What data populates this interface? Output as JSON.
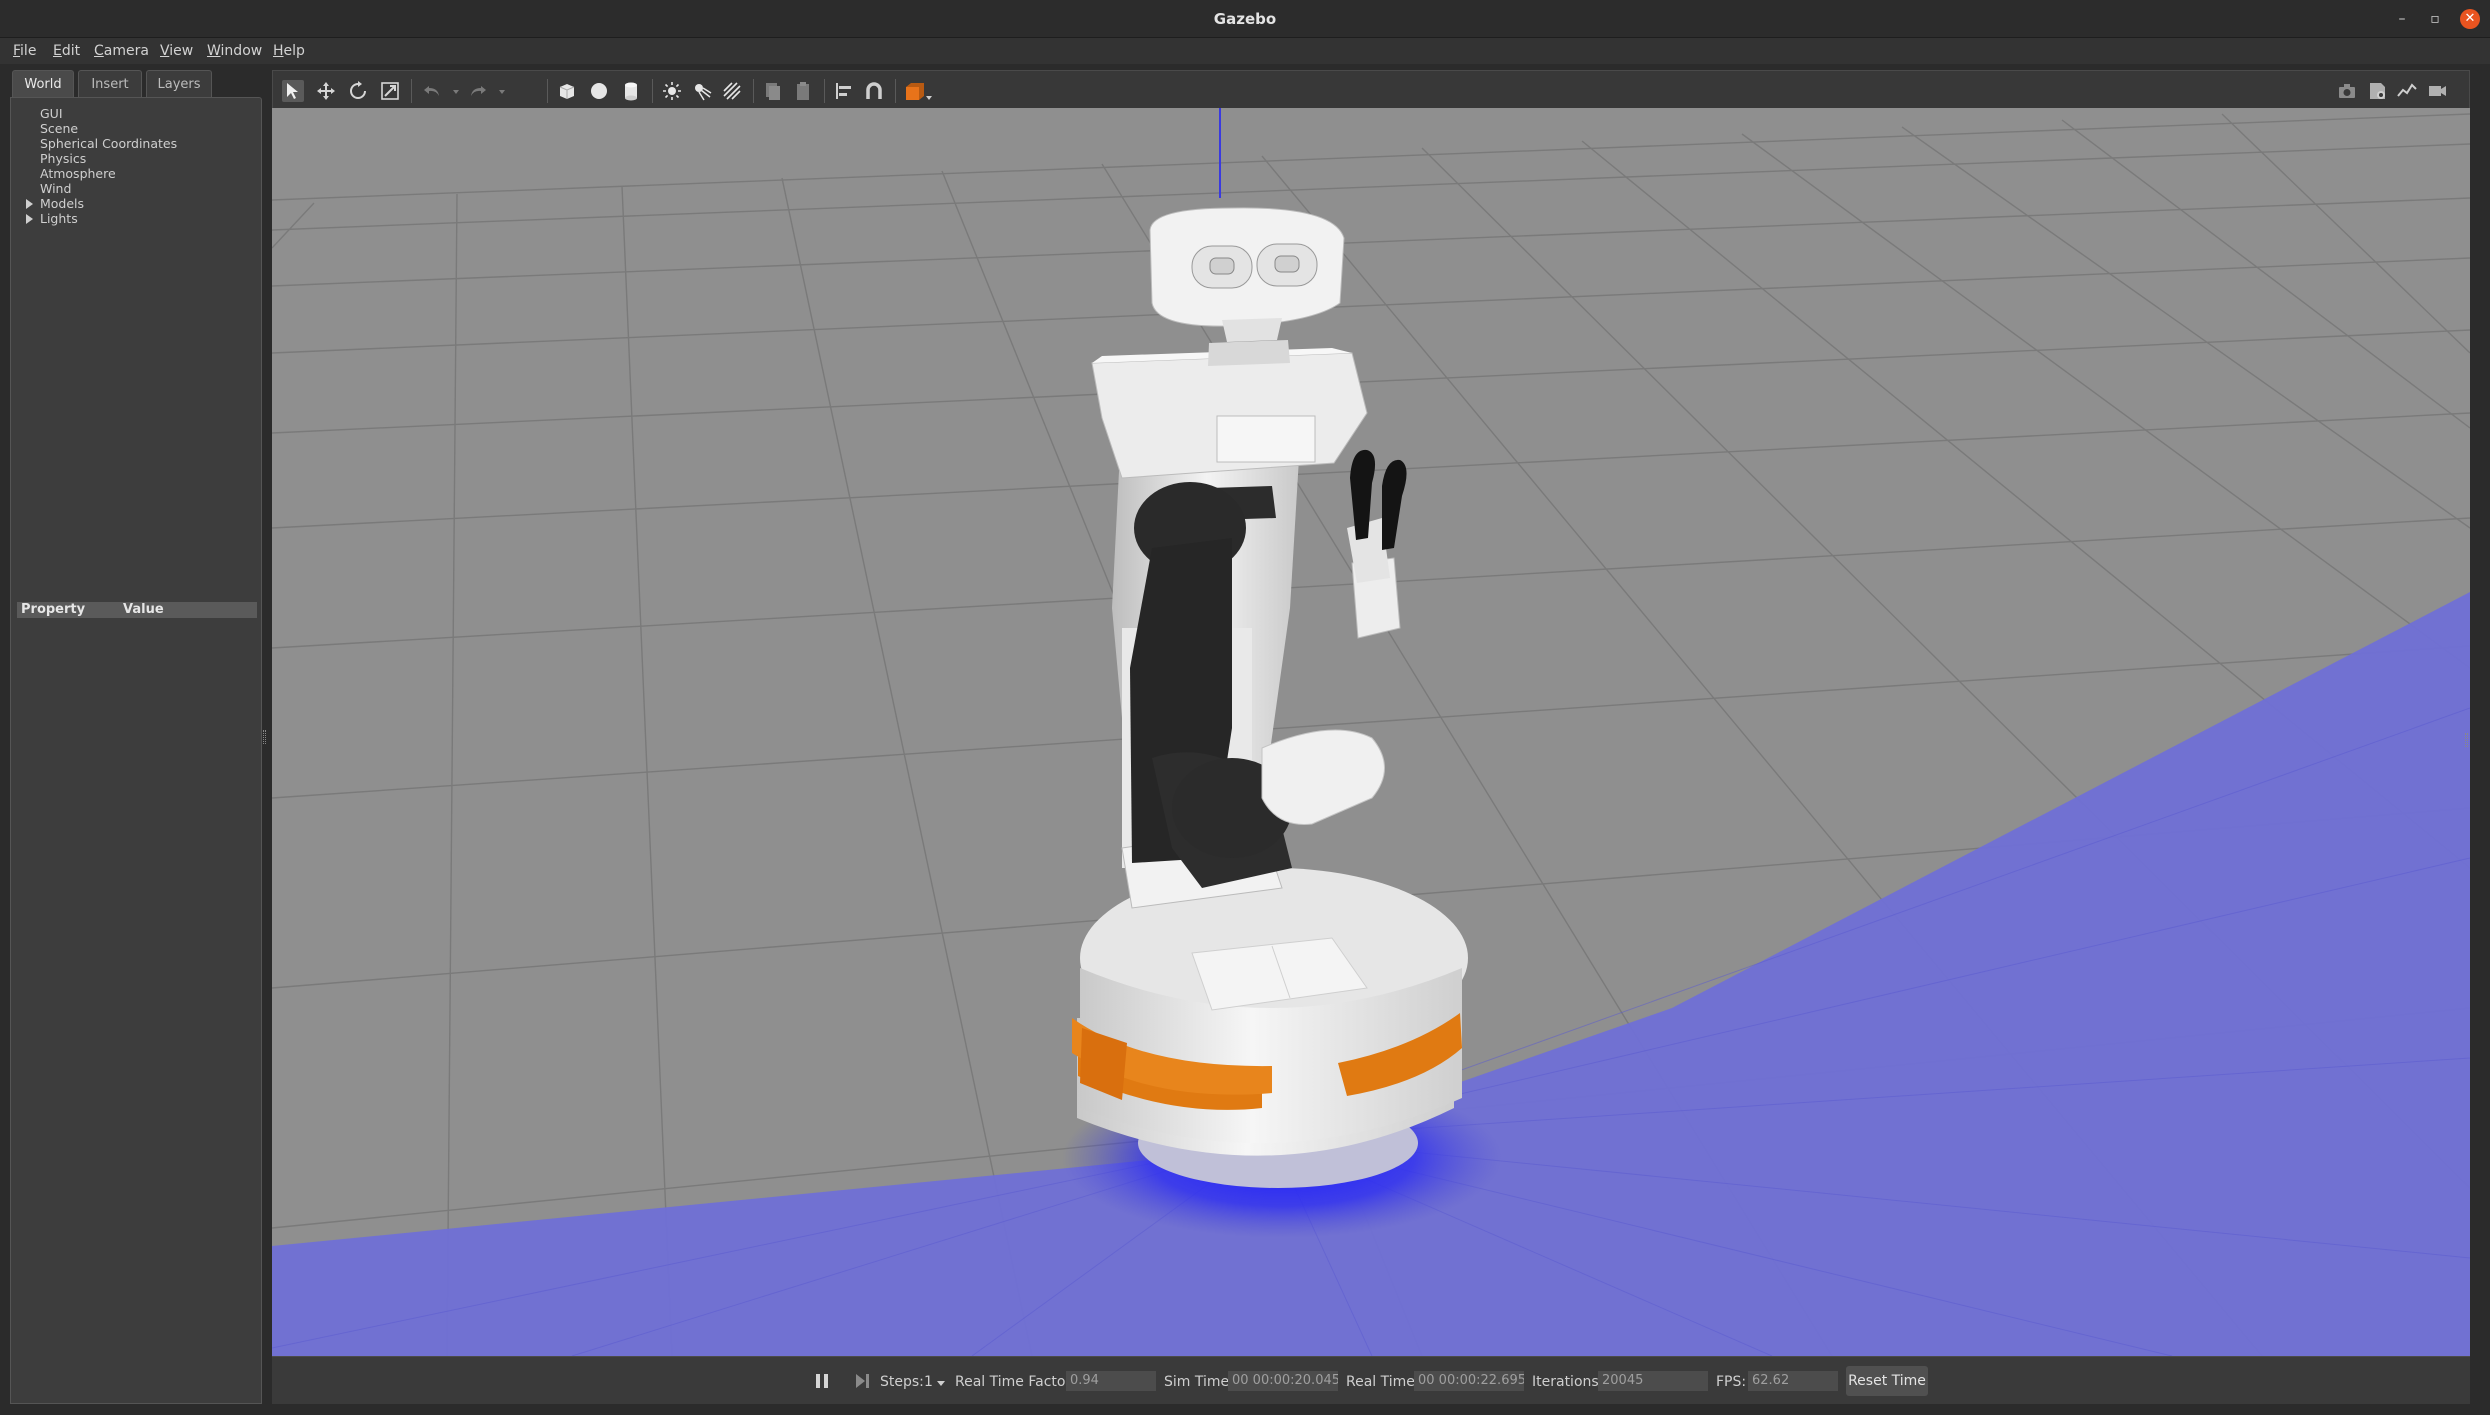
{
  "window": {
    "title": "Gazebo",
    "minimize": "–",
    "maximize": "▫",
    "close": "✕"
  },
  "menu": [
    {
      "label": "File",
      "mnemonic": "F",
      "rest": "ile"
    },
    {
      "label": "Edit",
      "mnemonic": "E",
      "rest": "dit"
    },
    {
      "label": "Camera",
      "mnemonic": "C",
      "rest": "amera"
    },
    {
      "label": "View",
      "mnemonic": "V",
      "rest": "iew"
    },
    {
      "label": "Window",
      "mnemonic": "W",
      "rest": "indow"
    },
    {
      "label": "Help",
      "mnemonic": "H",
      "rest": "elp"
    }
  ],
  "left_panel": {
    "tabs": [
      "World",
      "Insert",
      "Layers"
    ],
    "active_tab": "World",
    "tree": [
      "GUI",
      "Scene",
      "Spherical Coordinates",
      "Physics",
      "Atmosphere",
      "Wind",
      "Models",
      "Lights"
    ],
    "expandable": [
      "Models",
      "Lights"
    ],
    "property_header": {
      "property": "Property",
      "value": "Value"
    }
  },
  "toolbar": {
    "left_icons": [
      "select-arrow-icon",
      "translate-icon",
      "rotate-icon",
      "scale-icon",
      "undo-icon",
      "undo-dropdown-icon",
      "redo-icon",
      "redo-dropdown-icon",
      "box-shape-icon",
      "sphere-shape-icon",
      "cylinder-shape-icon",
      "point-light-icon",
      "spot-light-icon",
      "directional-light-icon",
      "copy-icon",
      "paste-icon",
      "align-icon",
      "snap-magnet-icon",
      "view-angle-icon"
    ],
    "right_icons": [
      "screenshot-camera-icon",
      "log-record-icon",
      "plot-icon",
      "video-record-icon"
    ]
  },
  "bottom_bar": {
    "steps_label": "Steps:",
    "steps_value": "1",
    "real_time_factor_label": "Real Time Factor:",
    "real_time_factor": "0.94",
    "sim_time_label": "Sim Time:",
    "sim_time": "00 00:00:20.045",
    "real_time_label": "Real Time:",
    "real_time": "00 00:00:22.695",
    "iterations_label": "Iterations:",
    "iterations": "20045",
    "fps_label": "FPS:",
    "fps": "62.62",
    "reset_button": "Reset Time"
  },
  "colors": {
    "background": "#2b2b2b",
    "ground": "#8f8f8f",
    "laser_scan": "#4b4bd6",
    "robot_orange": "#e07a12",
    "robot_white": "#efefef",
    "robot_black": "#262626",
    "toolbar_accent": "#e8731a"
  }
}
